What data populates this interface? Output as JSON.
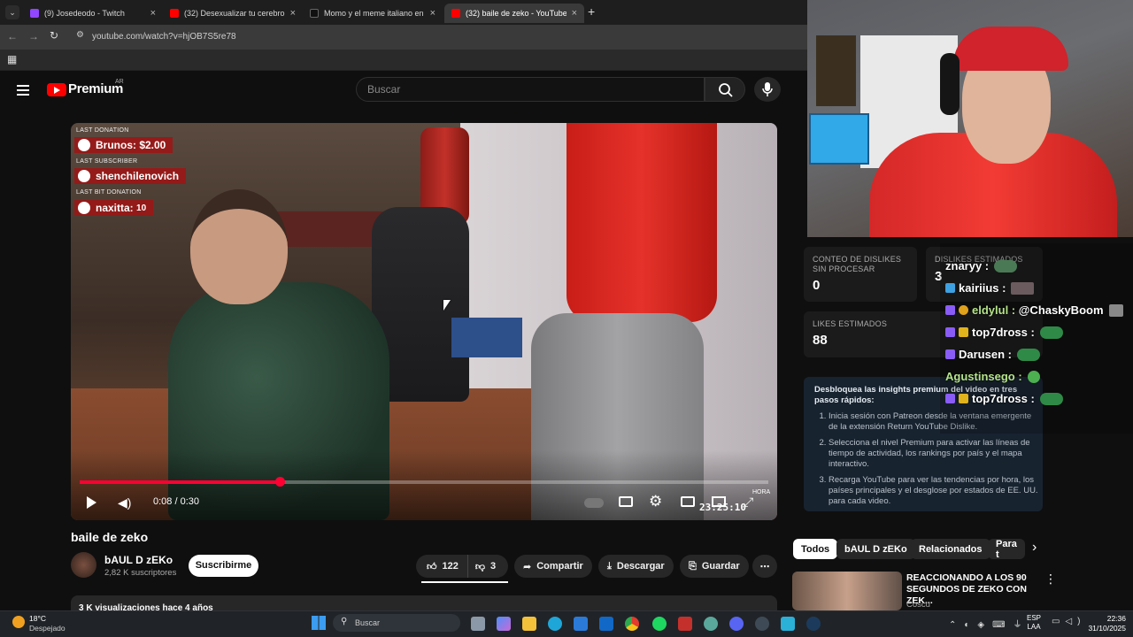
{
  "browser": {
    "tabs": [
      {
        "title": "(9) Josedeodo - Twitch",
        "color": "#9146ff"
      },
      {
        "title": "(32) Desexualizar tu cerebro en",
        "color": "#ff0000"
      },
      {
        "title": "Momo y el meme italiano en Ar",
        "color": "#111111"
      },
      {
        "title": "(32) baile de zeko - YouTube",
        "color": "#ff0000"
      }
    ],
    "url": "youtube.com/watch?v=hjOB7S5re78"
  },
  "yt": {
    "logo_text": "Premium",
    "region": "AR",
    "search_placeholder": "Buscar"
  },
  "video": {
    "time": "0:08 / 0:30",
    "progress": 0.29,
    "clock_overlay": "23:25:10",
    "hora_label": "HORA",
    "title": "baile de zeko",
    "stream_alerts": {
      "donation_label": "LAST DONATION",
      "donation": "Brunos: $2.00",
      "subscriber_label": "LAST SUBSCRIBER",
      "subscriber": "shenchilenovich",
      "bit_label": "LAST BIT DONATION",
      "bit_name": "naxitta:",
      "bit_amount": "10"
    }
  },
  "channel": {
    "name": "bAUL D zEKo",
    "subscribers": "2,82 K suscriptores",
    "subscribe_label": "Suscribirme"
  },
  "actions": {
    "likes": "122",
    "dislikes": "3",
    "share": "Compartir",
    "download": "Descargar",
    "save": "Guardar"
  },
  "views_line": "3 K visualizaciones hace 4 años",
  "rydstats": {
    "raw_dislikes_label": "CONTEO DE DISLIKES SIN PROCESAR",
    "raw_dislikes": "0",
    "est_dislikes_label": "DISLIKES ESTIMADOS",
    "est_dislikes": "3",
    "est_likes_label": "LIKES ESTIMADOS",
    "est_likes": "88"
  },
  "insights": {
    "heading": "Desbloquea las insights premium del video en tres pasos rápidos:",
    "steps": [
      "Inicia sesión con Patreon desde la ventana emergente de la extensión Return YouTube Dislike.",
      "Selecciona el nivel Premium para activar las líneas de tiempo de actividad, los rankings por país y el mapa interactivo.",
      "Recarga YouTube para ver las tendencias por hora, los países principales y el desglose por estados de EE. UU. para cada video."
    ]
  },
  "chips": [
    "Todos",
    "bAUL D zEKo",
    "Relacionados",
    "Para t"
  ],
  "recommended": {
    "title": "REACCIONANDO A LOS 90 SEGUNDOS DE ZEKO CON ZEK...",
    "channel": "Coscu"
  },
  "chat": [
    {
      "user": "znaryy :",
      "color": "#ffffff",
      "badge": "#2b6fd6",
      "text": ""
    },
    {
      "user": "kairiius :",
      "color": "#ffffff",
      "badge": "#3da0e0",
      "text": ""
    },
    {
      "user": "eldylul :",
      "color": "#b5e38a",
      "badge": "#8a5cf6",
      "text": "@ChaskyBoom"
    },
    {
      "user": "top7dross :",
      "color": "#ffffff",
      "badge": "#8a5cf6",
      "text": ""
    },
    {
      "user": "Darusen :",
      "color": "#ffffff",
      "badge": "#8a5cf6",
      "text": ""
    },
    {
      "user": "Agustinsego :",
      "color": "#b5e38a",
      "badge": "",
      "text": ""
    },
    {
      "user": "top7dross :",
      "color": "#ffffff",
      "badge": "#8a5cf6",
      "text": ""
    }
  ],
  "taskbar": {
    "weather_temp": "18°C",
    "weather_desc": "Despejado",
    "search": "Buscar",
    "lang": "ESP",
    "lang2": "LAA",
    "time": "22:36",
    "date": "31/10/2025"
  }
}
